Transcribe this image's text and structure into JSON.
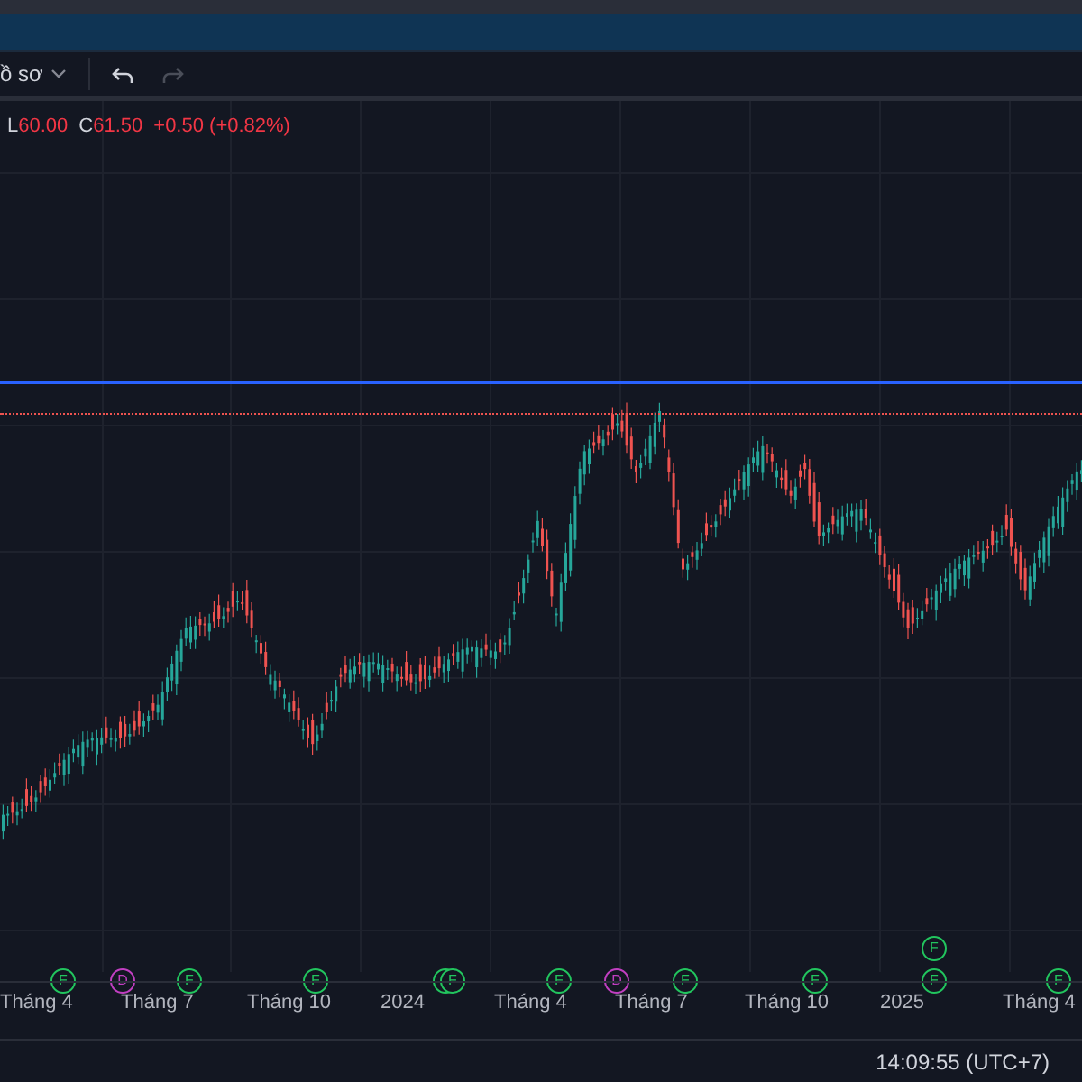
{
  "toolbar": {
    "profile_label": "ồ sơ",
    "history_buttons": [
      {
        "kind": "undo",
        "disabled": false
      },
      {
        "kind": "redo",
        "disabled": true
      }
    ]
  },
  "legend": {
    "values": [
      {
        "label": "L",
        "value": "60.00"
      },
      {
        "label": "C",
        "value": "61.50"
      }
    ],
    "change": "+0.50 (+0.82%)"
  },
  "events": [
    {
      "letter": "F",
      "color": "#22c55e"
    },
    {
      "letter": "D",
      "color": "#c13fc1"
    },
    {
      "letter": "F",
      "color": "#22c55e"
    },
    {
      "letter": "F",
      "color": "#22c55e"
    },
    {
      "color": "#22c55e"
    },
    {
      "letter": "F",
      "color": "#22c55e"
    },
    {
      "letter": "F",
      "color": "#22c55e"
    },
    {
      "letter": "D",
      "color": "#c13fc1"
    },
    {
      "letter": "F",
      "color": "#22c55e"
    },
    {
      "letter": "F",
      "color": "#22c55e"
    },
    {
      "letter": "F",
      "color": "#22c55e"
    },
    {
      "letter": "F",
      "color": "#22c55e"
    },
    {
      "letter": "F",
      "color": "#22c55e"
    }
  ],
  "time_axis": [
    "Tháng 4",
    "Tháng 7",
    "Tháng 10",
    "2024",
    "Tháng 4",
    "Tháng 7",
    "Tháng 10",
    "2025",
    "Tháng 4"
  ],
  "status_bar": {
    "clock": "14:09:55 (UTC+7)"
  }
}
